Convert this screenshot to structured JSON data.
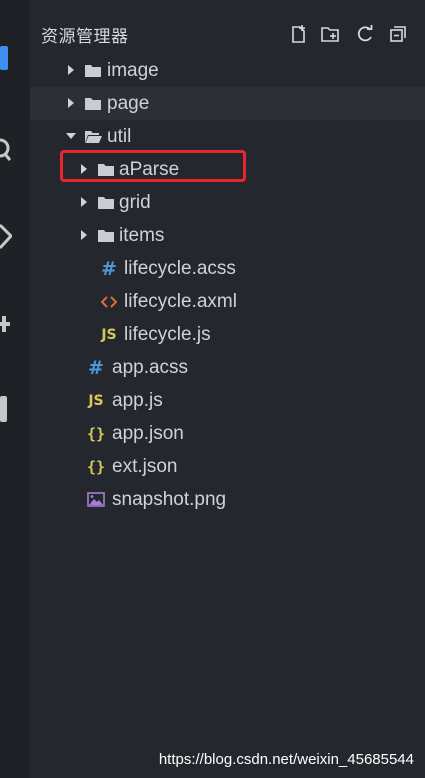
{
  "explorer": {
    "title": "资源管理器",
    "actions": [
      {
        "name": "new-file-icon"
      },
      {
        "name": "new-folder-icon"
      },
      {
        "name": "refresh-icon"
      },
      {
        "name": "collapse-all-icon"
      }
    ]
  },
  "tree": {
    "items": [
      {
        "label": "image",
        "type": "folder",
        "expanded": false,
        "depth": 0
      },
      {
        "label": "page",
        "type": "folder",
        "expanded": false,
        "depth": 0
      },
      {
        "label": "util",
        "type": "folder",
        "expanded": true,
        "depth": 0
      },
      {
        "label": "aParse",
        "type": "folder",
        "expanded": false,
        "depth": 1,
        "highlighted": true
      },
      {
        "label": "grid",
        "type": "folder",
        "expanded": false,
        "depth": 1
      },
      {
        "label": "items",
        "type": "folder",
        "expanded": false,
        "depth": 1
      },
      {
        "label": "lifecycle.acss",
        "type": "acss",
        "depth": 1
      },
      {
        "label": "lifecycle.axml",
        "type": "axml",
        "depth": 1
      },
      {
        "label": "lifecycle.js",
        "type": "js",
        "depth": 1
      },
      {
        "label": "app.acss",
        "type": "acss",
        "depth": 0
      },
      {
        "label": "app.js",
        "type": "js",
        "depth": 0
      },
      {
        "label": "app.json",
        "type": "json",
        "depth": 0
      },
      {
        "label": "ext.json",
        "type": "json",
        "depth": 0
      },
      {
        "label": "snapshot.png",
        "type": "image",
        "depth": 0
      }
    ]
  },
  "icon_glyphs": {
    "js": "JS",
    "acss": "#",
    "json": "{}"
  },
  "colors": {
    "background": "#24272d",
    "text": "#cfd2d6",
    "highlight_border": "#e8272a",
    "js": "#d6c85a",
    "acss": "#4f98d6",
    "axml": "#e06c3c",
    "image": "#a37fd6"
  },
  "watermark": "https://blog.csdn.net/weixin_45685544"
}
